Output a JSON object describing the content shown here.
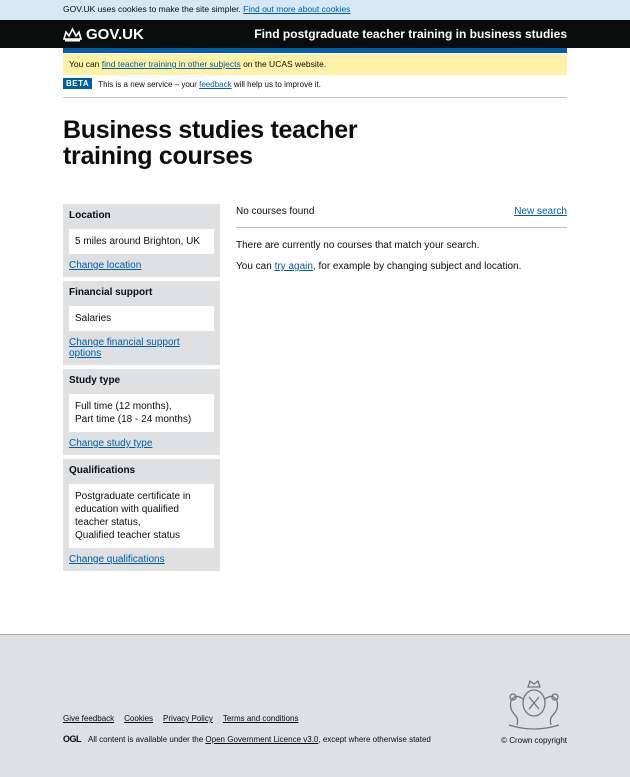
{
  "cookie_bar": {
    "text": "GOV.UK uses cookies to make the site simpler.",
    "link": "Find out more about cookies"
  },
  "header": {
    "logo": "GOV.UK",
    "service_name": "Find postgraduate teacher training in business studies"
  },
  "ucas_banner": {
    "prefix": "You can ",
    "link": "find teacher training in other subjects",
    "suffix": " on the UCAS website."
  },
  "beta": {
    "tag": "BETA",
    "prefix": "This is a new service – your ",
    "link": "feedback",
    "suffix": " will help us to improve it."
  },
  "page_title": "Business studies teacher training courses",
  "filters": [
    {
      "heading": "Location",
      "value": "5 miles around Brighton, UK",
      "link": "Change location"
    },
    {
      "heading": "Financial support",
      "value": "Salaries",
      "link": "Change financial support options"
    },
    {
      "heading": "Study type",
      "value": "Full time (12 months),\nPart time (18 - 24 months)",
      "link": "Change study type"
    },
    {
      "heading": "Qualifications",
      "value": "Postgraduate certificate in education with qualified teacher status,\nQualified teacher status",
      "link": "Change qualifications"
    }
  ],
  "results": {
    "count_text": "No courses found",
    "new_search": "New search",
    "no_match": "There are currently no courses that match your search.",
    "try_prefix": "You can ",
    "try_link": "try again",
    "try_suffix": ", for example by changing subject and location."
  },
  "footer": {
    "links": [
      "Give feedback",
      "Cookies",
      "Privacy Policy",
      "Terms and conditions"
    ],
    "ogl": "OGL",
    "licence_prefix": "All content is available under the ",
    "licence_link": "Open Government Licence v3.0",
    "licence_suffix": ", except where otherwise stated",
    "copyright": "© Crown copyright"
  }
}
